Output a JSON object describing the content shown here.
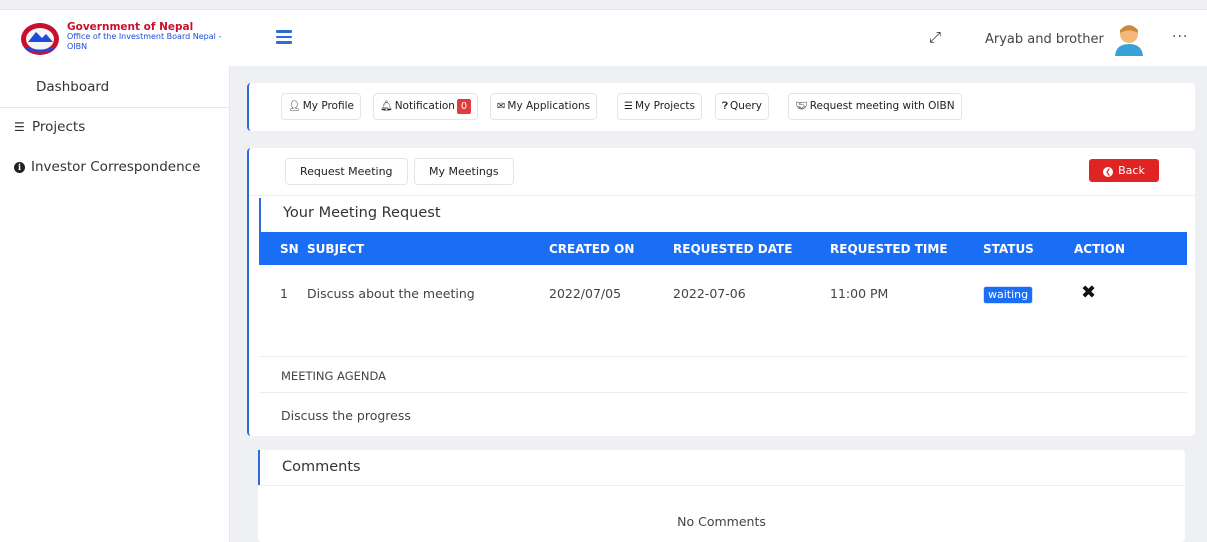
{
  "header": {
    "org_line1": "Government of Nepal",
    "org_line2": "Office of the Investment Board Nepal -",
    "org_line3": "OIBN",
    "user_name": "Aryab and brother",
    "more_label": "···"
  },
  "sidebar": {
    "items": [
      {
        "label": "Dashboard"
      },
      {
        "label": "Projects"
      },
      {
        "label": "Investor Correspondence"
      }
    ]
  },
  "tabs": [
    {
      "label": "My Profile"
    },
    {
      "label": "Notification",
      "badge": "0"
    },
    {
      "label": "My Applications"
    },
    {
      "label": "My Projects"
    },
    {
      "label": "Query"
    },
    {
      "label": "Request meeting with OIBN"
    }
  ],
  "meeting_tabs": [
    {
      "label": "Request Meeting"
    },
    {
      "label": "My Meetings"
    }
  ],
  "back_label": "Back",
  "section_title": "Your Meeting Request",
  "table": {
    "columns": [
      "SN",
      "SUBJECT",
      "CREATED ON",
      "REQUESTED DATE",
      "REQUESTED TIME",
      "STATUS",
      "ACTION"
    ],
    "rows": [
      {
        "sn": "1",
        "subject": "Discuss about the meeting",
        "created_on": "2022/07/05",
        "requested_date": "2022-07-06",
        "requested_time": "11:00 PM",
        "status": "waiting",
        "action": "✖"
      }
    ]
  },
  "agenda": {
    "label": "MEETING AGENDA",
    "text": "Discuss the progress"
  },
  "comments": {
    "title": "Comments",
    "empty": "No Comments"
  },
  "colors": {
    "accent": "#1a6ef5",
    "danger": "#e02424",
    "brand_red": "#c8102e"
  }
}
